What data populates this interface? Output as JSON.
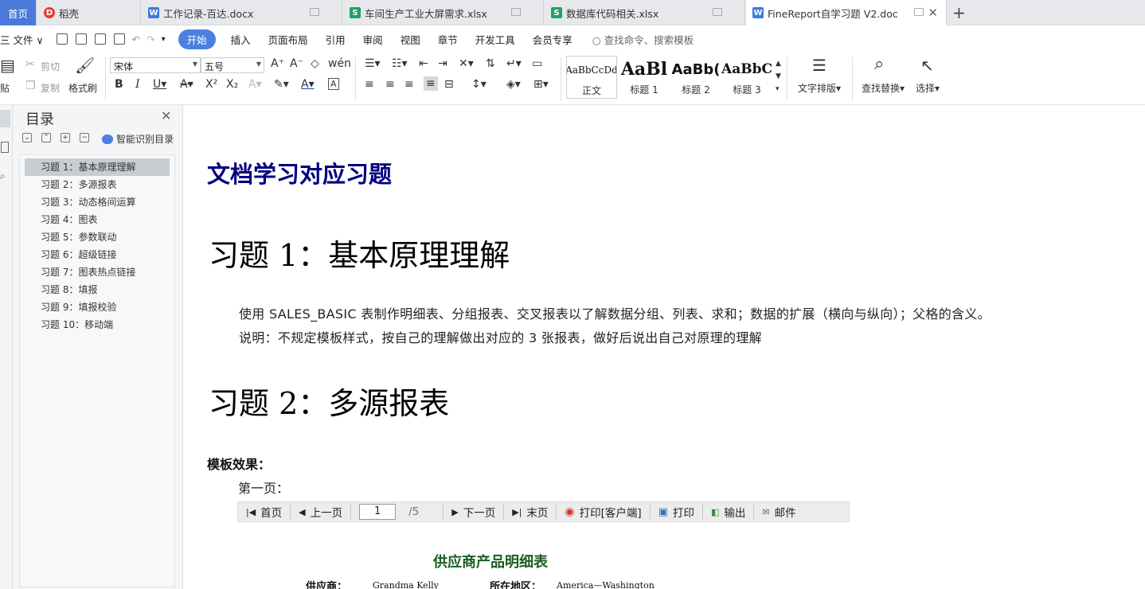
{
  "tabs": {
    "home": "首页",
    "items": [
      {
        "label": "稻壳",
        "color": "#e53935",
        "glyph": "D"
      },
      {
        "label": "工作记录-百达.docx",
        "color": "#3d7ae0",
        "glyph": "W"
      },
      {
        "label": "车间生产工业大屏需求.xlsx",
        "color": "#1fa463",
        "glyph": "S"
      },
      {
        "label": "数据库代码相关.xlsx",
        "color": "#1fa463",
        "glyph": "S"
      },
      {
        "label": "FineReport自学习题 V2.doc",
        "color": "#3d7ae0",
        "glyph": "W"
      }
    ],
    "new_tab": "+"
  },
  "menubar": {
    "file": "三 文件 ∨",
    "items": [
      "开始",
      "插入",
      "页面布局",
      "引用",
      "审阅",
      "视图",
      "章节",
      "开发工具",
      "会员专享"
    ],
    "search": "查找命令、搜索模板"
  },
  "ribbon": {
    "paste": "贴",
    "cut": "剪切",
    "copy": "复制",
    "format_painter": "格式刷",
    "font_name": "宋体",
    "font_size": "五号",
    "styles": [
      {
        "preview": "AaBbCcDd",
        "label": "正文"
      },
      {
        "preview": "AaBl",
        "label": "标题 1"
      },
      {
        "preview": "AaBb(",
        "label": "标题 2"
      },
      {
        "preview": "AaBbC",
        "label": "标题 3"
      }
    ],
    "text_layout": "文字排版",
    "find_replace": "查找替换",
    "select": "选择"
  },
  "toc": {
    "title": "目录",
    "smart": "智能识别目录",
    "items": [
      "习题 1：基本原理理解",
      "习题 2：多源报表",
      "习题 3：动态格间运算",
      "习题 4：图表",
      "习题 5：参数联动",
      "习题 6：超级链接",
      "习题 7：图表热点链接",
      "习题 8：填报",
      "习题 9：填报校验",
      "习题 10：移动端"
    ]
  },
  "document": {
    "title": "文档学习对应习题",
    "h1_1": "习题 1：基本原理理解",
    "para1": "使用 SALES_BASIC 表制作明细表、分组报表、交叉报表以了解数据分组、列表、求和；数据的扩展（横向与纵向）；父格的含义。",
    "para2": "说明：不规定模板样式，按自己的理解做出对应的 3 张报表，做好后说出自己对原理的理解",
    "h1_2": "习题 2：多源报表",
    "template_label": "模板效果：",
    "page1": "第一页：",
    "pager": {
      "first": "首页",
      "prev": "上一页",
      "page": "1",
      "total": "/5",
      "next": "下一页",
      "last": "末页",
      "print_client": "打印[客户端]",
      "print": "打印",
      "export": "输出",
      "mail": "邮件"
    },
    "report_title": "供应商产品明细表",
    "supplier_label": "供应商：",
    "supplier_value": "Grandma Kelly",
    "region_label": "所在地区：",
    "region_value": "America—Washington"
  }
}
